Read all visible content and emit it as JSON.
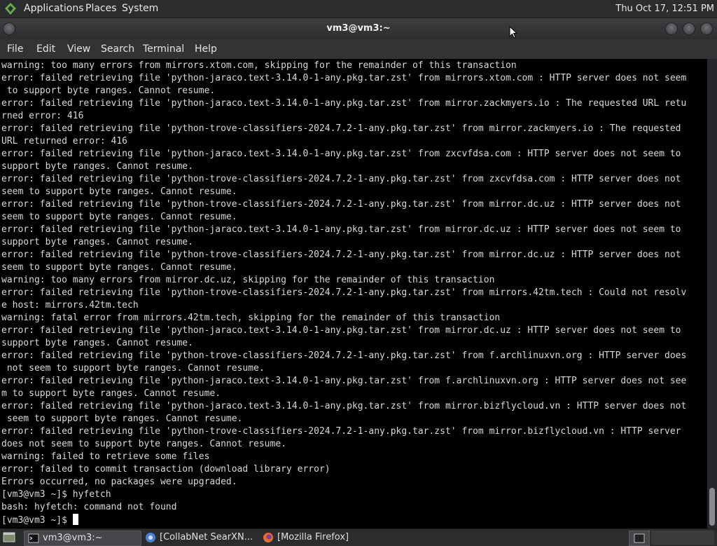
{
  "top_panel": {
    "menus": [
      "Applications",
      "Places",
      "System"
    ],
    "clock": "Thu Oct 17, 12:51 PM"
  },
  "window": {
    "title": "vm3@vm3:~"
  },
  "menubar": [
    "File",
    "Edit",
    "View",
    "Search",
    "Terminal",
    "Help"
  ],
  "terminal": {
    "lines": [
      "warning: too many errors from mirrors.xtom.com, skipping for the remainder of this transaction",
      "error: failed retrieving file 'python-jaraco.text-3.14.0-1-any.pkg.tar.zst' from mirrors.xtom.com : HTTP server does not seem",
      " to support byte ranges. Cannot resume.",
      "error: failed retrieving file 'python-jaraco.text-3.14.0-1-any.pkg.tar.zst' from mirror.zackmyers.io : The requested URL retu",
      "rned error: 416",
      "error: failed retrieving file 'python-trove-classifiers-2024.7.2-1-any.pkg.tar.zst' from mirror.zackmyers.io : The requested",
      "URL returned error: 416",
      "error: failed retrieving file 'python-jaraco.text-3.14.0-1-any.pkg.tar.zst' from zxcvfdsa.com : HTTP server does not seem to",
      "support byte ranges. Cannot resume.",
      "error: failed retrieving file 'python-trove-classifiers-2024.7.2-1-any.pkg.tar.zst' from zxcvfdsa.com : HTTP server does not",
      "seem to support byte ranges. Cannot resume.",
      "error: failed retrieving file 'python-trove-classifiers-2024.7.2-1-any.pkg.tar.zst' from mirror.dc.uz : HTTP server does not",
      "seem to support byte ranges. Cannot resume.",
      "error: failed retrieving file 'python-jaraco.text-3.14.0-1-any.pkg.tar.zst' from mirror.dc.uz : HTTP server does not seem to",
      "support byte ranges. Cannot resume.",
      "error: failed retrieving file 'python-trove-classifiers-2024.7.2-1-any.pkg.tar.zst' from mirror.dc.uz : HTTP server does not",
      "seem to support byte ranges. Cannot resume.",
      "warning: too many errors from mirror.dc.uz, skipping for the remainder of this transaction",
      "error: failed retrieving file 'python-trove-classifiers-2024.7.2-1-any.pkg.tar.zst' from mirrors.42tm.tech : Could not resolv",
      "e host: mirrors.42tm.tech",
      "warning: fatal error from mirrors.42tm.tech, skipping for the remainder of this transaction",
      "error: failed retrieving file 'python-jaraco.text-3.14.0-1-any.pkg.tar.zst' from mirror.dc.uz : HTTP server does not seem to",
      "support byte ranges. Cannot resume.",
      "error: failed retrieving file 'python-trove-classifiers-2024.7.2-1-any.pkg.tar.zst' from f.archlinuxvn.org : HTTP server does",
      " not seem to support byte ranges. Cannot resume.",
      "error: failed retrieving file 'python-jaraco.text-3.14.0-1-any.pkg.tar.zst' from f.archlinuxvn.org : HTTP server does not see",
      "m to support byte ranges. Cannot resume.",
      "error: failed retrieving file 'python-jaraco.text-3.14.0-1-any.pkg.tar.zst' from mirror.bizflycloud.vn : HTTP server does not",
      " seem to support byte ranges. Cannot resume.",
      "error: failed retrieving file 'python-trove-classifiers-2024.7.2-1-any.pkg.tar.zst' from mirror.bizflycloud.vn : HTTP server",
      "does not seem to support byte ranges. Cannot resume.",
      "warning: failed to retrieve some files",
      "error: failed to commit transaction (download library error)",
      "Errors occurred, no packages were upgraded.",
      "[vm3@vm3 ~]$ hyfetch",
      "bash: hyfetch: command not found",
      "[vm3@vm3 ~]$ "
    ]
  },
  "taskbar": {
    "tasks": [
      {
        "label": "vm3@vm3:~",
        "icon": "terminal-icon",
        "active": true
      },
      {
        "label": "[CollabNet SearXN...",
        "icon": "chromium-icon",
        "active": false
      },
      {
        "label": "[Mozilla Firefox]",
        "icon": "firefox-icon",
        "active": false
      }
    ]
  },
  "colors": {
    "terminal_bg": "#000000",
    "terminal_fg": "#d8d8d8",
    "panel_bg": "#2b2c2e"
  }
}
